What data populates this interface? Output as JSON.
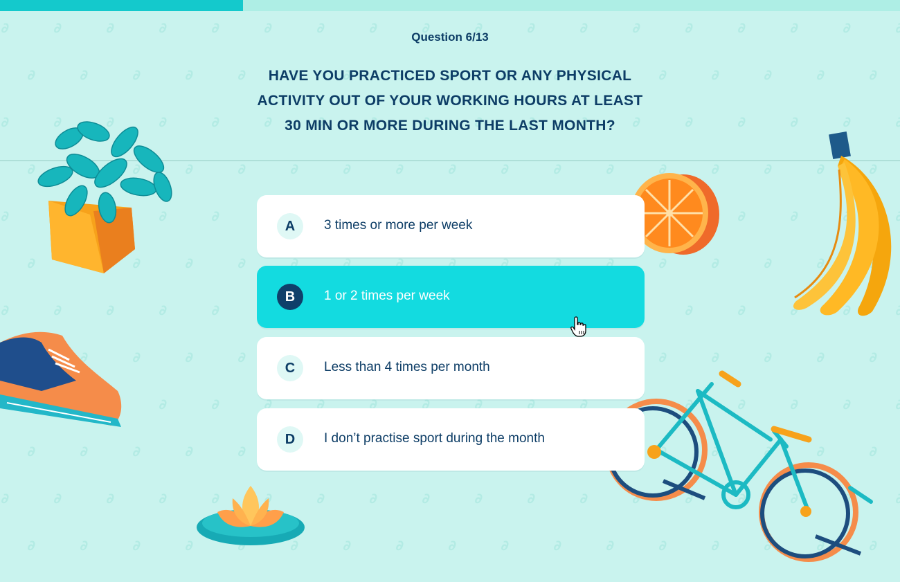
{
  "progress": {
    "fraction": 0.27
  },
  "quiz": {
    "counter": "Question 6/13",
    "question_lines": [
      "HAVE YOU PRACTICED SPORT OR ANY PHYSICAL",
      "ACTIVITY OUT OF YOUR WORKING HOURS AT LEAST",
      "30 MIN OR MORE DURING THE LAST MONTH?"
    ],
    "answers": [
      {
        "letter": "A",
        "text": "3 times or more per week",
        "selected": false
      },
      {
        "letter": "B",
        "text": "1 or 2 times per week",
        "selected": true
      },
      {
        "letter": "C",
        "text": "Less than 4 times per month",
        "selected": false
      },
      {
        "letter": "D",
        "text": "I don’t practise sport during the month",
        "selected": false
      }
    ]
  },
  "colors": {
    "background": "#c9f3ee",
    "accent": "#13dbe0",
    "text": "#0d3d66",
    "selected_letter_bg": "#0f3f6a"
  },
  "icons": [
    "plant-illustration",
    "orange-illustration",
    "banana-illustration",
    "sneaker-illustration",
    "lotus-illustration",
    "bicycle-illustration",
    "hand-pointer-icon"
  ]
}
